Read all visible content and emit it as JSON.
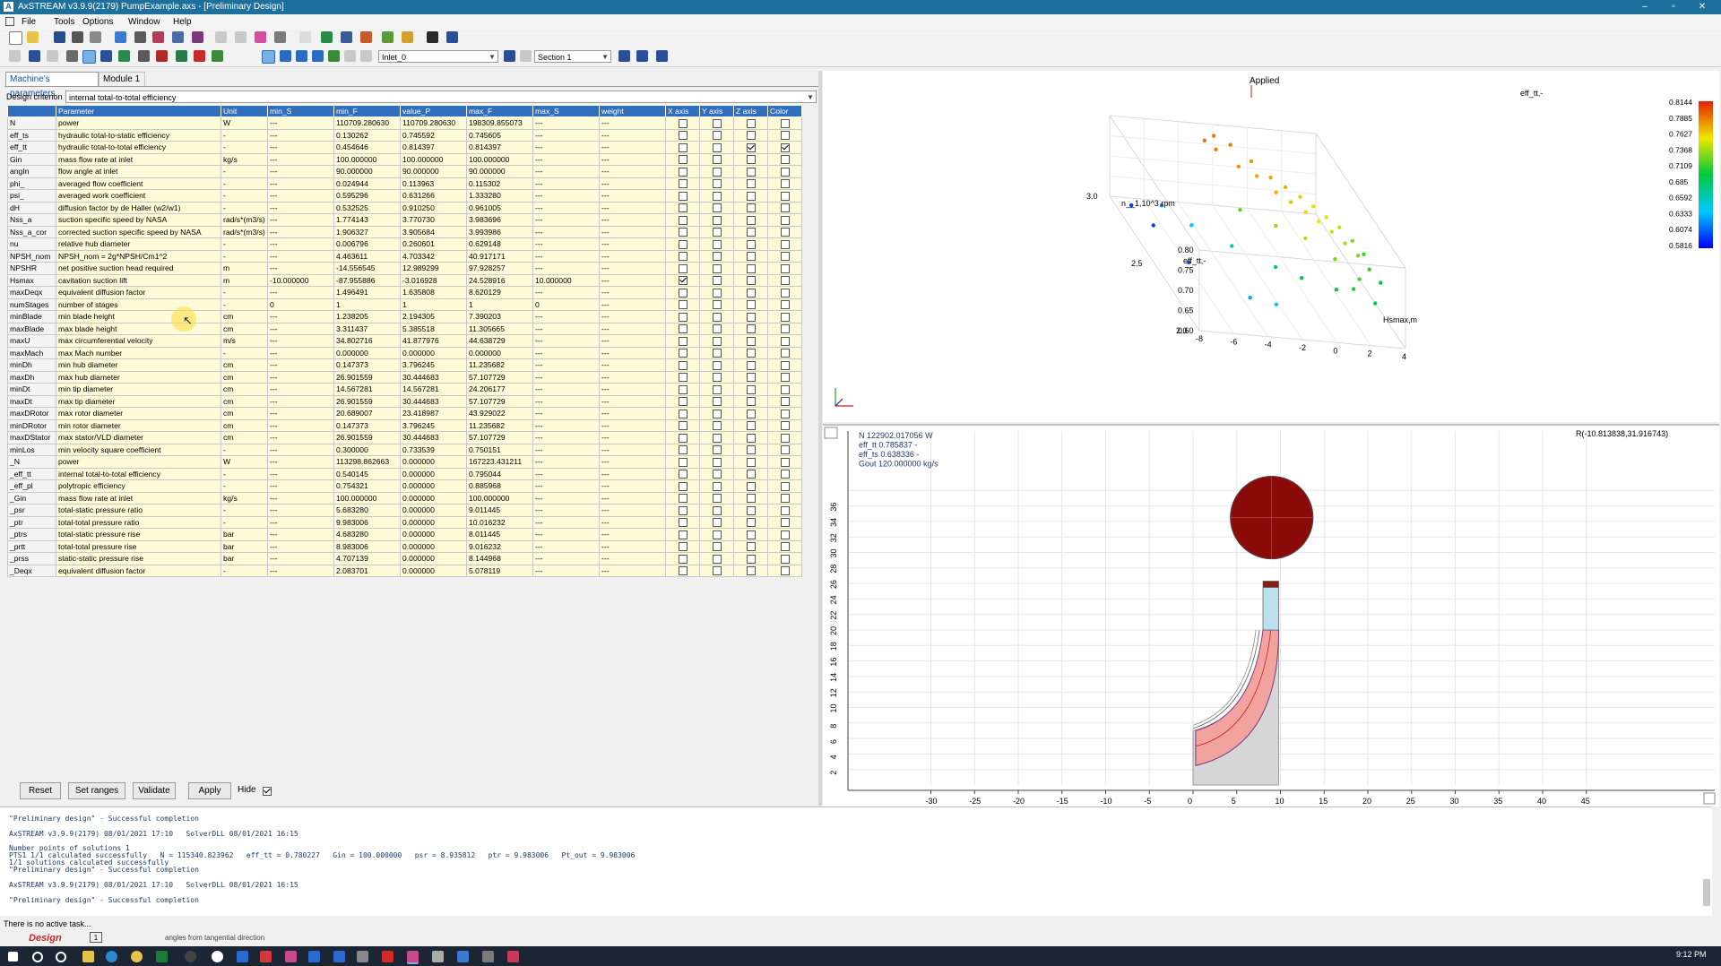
{
  "window": {
    "title": "AxSTREAM  v3.9.9(2179)  PumpExample.axs - [Preliminary Design]",
    "minimize": "–",
    "maximize": "▫",
    "close": "✕"
  },
  "menu": [
    "File",
    "Tools",
    "Options",
    "Window",
    "Help"
  ],
  "toolbar": {
    "inlet_combo": "Inlet_0",
    "section_combo": "Section 1"
  },
  "tabs": [
    "Machine's parameters",
    "Module 1"
  ],
  "design_criterion": {
    "label": "Design criterion",
    "value": "internal total-to-total efficiency"
  },
  "table": {
    "headers": [
      "",
      "Parameter",
      "Unit",
      "min_S",
      "min_F",
      "value_P",
      "max_F",
      "max_S",
      "weight",
      "X axis",
      "Y axis",
      "Z axis",
      "Color"
    ],
    "rows": [
      {
        "sym": "N",
        "param": "power",
        "unit": "W",
        "min_s": "---",
        "min_f": "110709.280630",
        "val": "110709.280630",
        "max_f": "198309.855073",
        "max_s": "---",
        "w": "---",
        "x": false,
        "y": false,
        "z": false,
        "c": false
      },
      {
        "sym": "eff_ts",
        "param": "hydraulic total-to-static efficiency",
        "unit": "-",
        "min_s": "---",
        "min_f": "0.130262",
        "val": "0.745592",
        "max_f": "0.745605",
        "max_s": "---",
        "w": "---",
        "x": false,
        "y": false,
        "z": false,
        "c": false
      },
      {
        "sym": "eff_tt",
        "param": "hydraulic total-to-total efficiency",
        "unit": "-",
        "min_s": "---",
        "min_f": "0.454646",
        "val": "0.814397",
        "max_f": "0.814397",
        "max_s": "---",
        "w": "---",
        "x": false,
        "y": false,
        "z": true,
        "c": true
      },
      {
        "sym": "Gin",
        "param": "mass flow rate at inlet",
        "unit": "kg/s",
        "min_s": "---",
        "min_f": "100.000000",
        "val": "100.000000",
        "max_f": "100.000000",
        "max_s": "---",
        "w": "---",
        "x": false,
        "y": false,
        "z": false,
        "c": false
      },
      {
        "sym": "angIn",
        "param": "flow angle at inlet",
        "unit": "-",
        "min_s": "---",
        "min_f": "90.000000",
        "val": "90.000000",
        "max_f": "90.000000",
        "max_s": "---",
        "w": "---",
        "x": false,
        "y": false,
        "z": false,
        "c": false
      },
      {
        "sym": "phi_",
        "param": "averaged flow coefficient",
        "unit": "-",
        "min_s": "---",
        "min_f": "0.024944",
        "val": "0.113963",
        "max_f": "0.115302",
        "max_s": "---",
        "w": "---",
        "x": false,
        "y": false,
        "z": false,
        "c": false
      },
      {
        "sym": "psi_",
        "param": "averaged work coefficient",
        "unit": "-",
        "min_s": "---",
        "min_f": "0.595296",
        "val": "0.631266",
        "max_f": "1.333280",
        "max_s": "---",
        "w": "---",
        "x": false,
        "y": false,
        "z": false,
        "c": false
      },
      {
        "sym": "dH",
        "param": "diffusion factor by de Haller (w2/w1)",
        "unit": "-",
        "min_s": "---",
        "min_f": "0.532525",
        "val": "0.910250",
        "max_f": "0.961005",
        "max_s": "---",
        "w": "---",
        "x": false,
        "y": false,
        "z": false,
        "c": false
      },
      {
        "sym": "Nss_a",
        "param": "suction specific speed by NASA",
        "unit": "rad/s*(m3/s)",
        "min_s": "---",
        "min_f": "1.774143",
        "val": "3.770730",
        "max_f": "3.983696",
        "max_s": "---",
        "w": "---",
        "x": false,
        "y": false,
        "z": false,
        "c": false
      },
      {
        "sym": "Nss_a_cor",
        "param": "corrected suction specific speed by NASA",
        "unit": "rad/s*(m3/s)",
        "min_s": "---",
        "min_f": "1.906327",
        "val": "3.905684",
        "max_f": "3.993986",
        "max_s": "---",
        "w": "---",
        "x": false,
        "y": false,
        "z": false,
        "c": false
      },
      {
        "sym": "nu",
        "param": "relative hub diameter",
        "unit": "-",
        "min_s": "---",
        "min_f": "0.006796",
        "val": "0.260601",
        "max_f": "0.629148",
        "max_s": "---",
        "w": "---",
        "x": false,
        "y": false,
        "z": false,
        "c": false
      },
      {
        "sym": "NPSH_nom",
        "param": "NPSH_nom = 2g*NPSH/Cm1^2",
        "unit": "-",
        "min_s": "---",
        "min_f": "4.463611",
        "val": "4.703342",
        "max_f": "40.917171",
        "max_s": "---",
        "w": "---",
        "x": false,
        "y": false,
        "z": false,
        "c": false
      },
      {
        "sym": "NPSHR",
        "param": "net positive suction head required",
        "unit": "m",
        "min_s": "---",
        "min_f": "-14.556545",
        "val": "12.989299",
        "max_f": "97.928257",
        "max_s": "---",
        "w": "---",
        "x": false,
        "y": false,
        "z": false,
        "c": false
      },
      {
        "sym": "Hsmax",
        "param": "cavitation suction lift",
        "unit": "m",
        "min_s": "-10.000000",
        "min_f": "-87.955886",
        "val": "-3.016928",
        "max_f": "24.528916",
        "max_s": "10.000000",
        "w": "---",
        "x": true,
        "y": false,
        "z": false,
        "c": false
      },
      {
        "sym": "maxDeqx",
        "param": "equivalent diffusion factor",
        "unit": "-",
        "min_s": "---",
        "min_f": "1.496491",
        "val": "1.635808",
        "max_f": "8.620129",
        "max_s": "---",
        "w": "---",
        "x": false,
        "y": false,
        "z": false,
        "c": false
      },
      {
        "sym": "numStages",
        "param": "number of stages",
        "unit": "-",
        "min_s": "0",
        "min_f": "1",
        "val": "1",
        "max_f": "1",
        "max_s": "0",
        "w": "---",
        "x": false,
        "y": false,
        "z": false,
        "c": false
      },
      {
        "sym": "minBlade",
        "param": "min blade height",
        "unit": "cm",
        "min_s": "---",
        "min_f": "1.238205",
        "val": "2.194305",
        "max_f": "7.390203",
        "max_s": "---",
        "w": "---",
        "x": false,
        "y": false,
        "z": false,
        "c": false
      },
      {
        "sym": "maxBlade",
        "param": "max blade height",
        "unit": "cm",
        "min_s": "---",
        "min_f": "3.311437",
        "val": "5.385518",
        "max_f": "11.305665",
        "max_s": "---",
        "w": "---",
        "x": false,
        "y": false,
        "z": false,
        "c": false
      },
      {
        "sym": "maxU",
        "param": "max circumferential velocity",
        "unit": "m/s",
        "min_s": "---",
        "min_f": "34.802716",
        "val": "41.877976",
        "max_f": "44.638729",
        "max_s": "---",
        "w": "---",
        "x": false,
        "y": false,
        "z": false,
        "c": false
      },
      {
        "sym": "maxMach",
        "param": "max Mach number",
        "unit": "-",
        "min_s": "---",
        "min_f": "0.000000",
        "val": "0.000000",
        "max_f": "0.000000",
        "max_s": "---",
        "w": "---",
        "x": false,
        "y": false,
        "z": false,
        "c": false
      },
      {
        "sym": "minDh",
        "param": "min hub diameter",
        "unit": "cm",
        "min_s": "---",
        "min_f": "0.147373",
        "val": "3.796245",
        "max_f": "11.235682",
        "max_s": "---",
        "w": "---",
        "x": false,
        "y": false,
        "z": false,
        "c": false
      },
      {
        "sym": "maxDh",
        "param": "max hub diameter",
        "unit": "cm",
        "min_s": "---",
        "min_f": "26.901559",
        "val": "30.444683",
        "max_f": "57.107729",
        "max_s": "---",
        "w": "---",
        "x": false,
        "y": false,
        "z": false,
        "c": false
      },
      {
        "sym": "minDt",
        "param": "min tip diameter",
        "unit": "cm",
        "min_s": "---",
        "min_f": "14.567281",
        "val": "14.567281",
        "max_f": "24.206177",
        "max_s": "---",
        "w": "---",
        "x": false,
        "y": false,
        "z": false,
        "c": false
      },
      {
        "sym": "maxDt",
        "param": "max tip diameter",
        "unit": "cm",
        "min_s": "---",
        "min_f": "26.901559",
        "val": "30.444683",
        "max_f": "57.107729",
        "max_s": "---",
        "w": "---",
        "x": false,
        "y": false,
        "z": false,
        "c": false
      },
      {
        "sym": "maxDRotor",
        "param": "max rotor diameter",
        "unit": "cm",
        "min_s": "---",
        "min_f": "20.689007",
        "val": "23.418987",
        "max_f": "43.929022",
        "max_s": "---",
        "w": "---",
        "x": false,
        "y": false,
        "z": false,
        "c": false
      },
      {
        "sym": "minDRotor",
        "param": "min rotor diameter",
        "unit": "cm",
        "min_s": "---",
        "min_f": "0.147373",
        "val": "3.796245",
        "max_f": "11.235682",
        "max_s": "---",
        "w": "---",
        "x": false,
        "y": false,
        "z": false,
        "c": false
      },
      {
        "sym": "maxDStator",
        "param": "max stator/VLD diameter",
        "unit": "cm",
        "min_s": "---",
        "min_f": "26.901559",
        "val": "30.444683",
        "max_f": "57.107729",
        "max_s": "---",
        "w": "---",
        "x": false,
        "y": false,
        "z": false,
        "c": false
      },
      {
        "sym": "minLos",
        "param": "min velocity square coefficient",
        "unit": "-",
        "min_s": "---",
        "min_f": "0.300000",
        "val": "0.733539",
        "max_f": "0.750151",
        "max_s": "---",
        "w": "---",
        "x": false,
        "y": false,
        "z": false,
        "c": false
      },
      {
        "sym": "_N",
        "param": "power",
        "unit": "W",
        "min_s": "---",
        "min_f": "113298.862663",
        "val": "0.000000",
        "max_f": "167223.431211",
        "max_s": "---",
        "w": "---",
        "x": false,
        "y": false,
        "z": false,
        "c": false
      },
      {
        "sym": "_eff_tt",
        "param": "internal total-to-total efficiency",
        "unit": "-",
        "min_s": "---",
        "min_f": "0.540145",
        "val": "0.000000",
        "max_f": "0.795044",
        "max_s": "---",
        "w": "---",
        "x": false,
        "y": false,
        "z": false,
        "c": false
      },
      {
        "sym": "_eff_pl",
        "param": "polytropic efficiency",
        "unit": "-",
        "min_s": "---",
        "min_f": "0.754321",
        "val": "0.000000",
        "max_f": "0.885968",
        "max_s": "---",
        "w": "---",
        "x": false,
        "y": false,
        "z": false,
        "c": false
      },
      {
        "sym": "_Gin",
        "param": "mass flow rate at inlet",
        "unit": "kg/s",
        "min_s": "---",
        "min_f": "100.000000",
        "val": "0.000000",
        "max_f": "100.000000",
        "max_s": "---",
        "w": "---",
        "x": false,
        "y": false,
        "z": false,
        "c": false
      },
      {
        "sym": "_psr",
        "param": "total-static pressure ratio",
        "unit": "-",
        "min_s": "---",
        "min_f": "5.683280",
        "val": "0.000000",
        "max_f": "9.011445",
        "max_s": "---",
        "w": "---",
        "x": false,
        "y": false,
        "z": false,
        "c": false
      },
      {
        "sym": "_ptr",
        "param": "total-total pressure ratio",
        "unit": "-",
        "min_s": "---",
        "min_f": "9.983006",
        "val": "0.000000",
        "max_f": "10.016232",
        "max_s": "---",
        "w": "---",
        "x": false,
        "y": false,
        "z": false,
        "c": false
      },
      {
        "sym": "_ptrs",
        "param": "total-static pressure rise",
        "unit": "bar",
        "min_s": "---",
        "min_f": "4.683280",
        "val": "0.000000",
        "max_f": "8.011445",
        "max_s": "---",
        "w": "---",
        "x": false,
        "y": false,
        "z": false,
        "c": false
      },
      {
        "sym": "_prtt",
        "param": "total-total pressure rise",
        "unit": "bar",
        "min_s": "---",
        "min_f": "8.983006",
        "val": "0.000000",
        "max_f": "9.016232",
        "max_s": "---",
        "w": "---",
        "x": false,
        "y": false,
        "z": false,
        "c": false
      },
      {
        "sym": "_prss",
        "param": "static-static pressure rise",
        "unit": "bar",
        "min_s": "---",
        "min_f": "4.707139",
        "val": "0.000000",
        "max_f": "8.144968",
        "max_s": "---",
        "w": "---",
        "x": false,
        "y": false,
        "z": false,
        "c": false
      },
      {
        "sym": "_Deqx",
        "param": "equivalent diffusion factor",
        "unit": "-",
        "min_s": "---",
        "min_f": "2.083701",
        "val": "0.000000",
        "max_f": "5.078119",
        "max_s": "---",
        "w": "---",
        "x": false,
        "y": false,
        "z": false,
        "c": false
      }
    ]
  },
  "buttons": {
    "reset": "Reset",
    "set_ranges": "Set ranges",
    "validate": "Validate",
    "apply": "Apply",
    "hide": "Hide"
  },
  "plot3d": {
    "title": "Applied",
    "x_label": "Hsmax,m",
    "y_label": "n__1,10^3 rpm",
    "z_label": "eff_tt,-",
    "color_label": "eff_tt,-",
    "x_ticks": [
      "-8",
      "-6",
      "-4",
      "-2",
      "0",
      "2",
      "4"
    ],
    "z_ticks": [
      "0.80",
      "0.75",
      "0.70",
      "0.65",
      "0.60"
    ],
    "y_ticks": [
      "3.0",
      "2.5",
      "2.0"
    ],
    "colorbar_ticks": [
      "0.8144",
      "0.7885",
      "0.7627",
      "0.7368",
      "0.7109",
      "0.685",
      "0.6592",
      "0.6333",
      "0.6074",
      "0.5816"
    ]
  },
  "chart_data": {
    "type": "scatter",
    "title": "Applied",
    "xlabel": "Hsmax,m",
    "ylabel": "n__1,10^3 rpm",
    "zlabel": "eff_tt,-",
    "xlim": [
      -8,
      4
    ],
    "ylim": [
      2.0,
      3.0
    ],
    "zlim": [
      0.6,
      0.8
    ],
    "color_range": [
      0.5816,
      0.8144
    ],
    "points": [
      {
        "x": -3.0,
        "y": 2.9,
        "z": 0.79
      },
      {
        "x": -2.2,
        "y": 2.95,
        "z": 0.788
      },
      {
        "x": -1.5,
        "y": 2.9,
        "z": 0.785
      },
      {
        "x": -0.8,
        "y": 2.8,
        "z": 0.78
      },
      {
        "x": -0.2,
        "y": 2.7,
        "z": 0.775
      },
      {
        "x": 0.4,
        "y": 2.65,
        "z": 0.77
      },
      {
        "x": 1.0,
        "y": 2.6,
        "z": 0.765
      },
      {
        "x": 1.5,
        "y": 2.55,
        "z": 0.76
      },
      {
        "x": 2.0,
        "y": 2.5,
        "z": 0.752
      },
      {
        "x": 2.5,
        "y": 2.45,
        "z": 0.745
      },
      {
        "x": 3.0,
        "y": 2.4,
        "z": 0.73
      },
      {
        "x": 3.4,
        "y": 2.35,
        "z": 0.715
      },
      {
        "x": -2.6,
        "y": 2.85,
        "z": 0.786
      },
      {
        "x": -1.8,
        "y": 2.75,
        "z": 0.78
      },
      {
        "x": -1.0,
        "y": 2.7,
        "z": 0.776
      },
      {
        "x": -0.4,
        "y": 2.6,
        "z": 0.771
      },
      {
        "x": 0.2,
        "y": 2.55,
        "z": 0.766
      },
      {
        "x": 0.8,
        "y": 2.5,
        "z": 0.76
      },
      {
        "x": 1.3,
        "y": 2.45,
        "z": 0.755
      },
      {
        "x": 1.8,
        "y": 2.4,
        "z": 0.748
      },
      {
        "x": 2.3,
        "y": 2.35,
        "z": 0.738
      },
      {
        "x": 2.8,
        "y": 2.3,
        "z": 0.726
      },
      {
        "x": 3.2,
        "y": 2.25,
        "z": 0.71
      },
      {
        "x": 3.6,
        "y": 2.2,
        "z": 0.695
      },
      {
        "x": -5.5,
        "y": 2.9,
        "z": 0.62
      },
      {
        "x": -4.8,
        "y": 2.7,
        "z": 0.64
      },
      {
        "x": -3.5,
        "y": 2.5,
        "z": 0.66
      },
      {
        "x": -6.5,
        "y": 2.8,
        "z": 0.6
      },
      {
        "x": -2.0,
        "y": 2.3,
        "z": 0.68
      },
      {
        "x": -1.0,
        "y": 2.2,
        "z": 0.69
      },
      {
        "x": 0.5,
        "y": 2.1,
        "z": 0.7
      },
      {
        "x": 1.5,
        "y": 2.1,
        "z": 0.705
      },
      {
        "x": 2.5,
        "y": 2.05,
        "z": 0.69
      },
      {
        "x": -4.0,
        "y": 2.2,
        "z": 0.63
      },
      {
        "x": -3.0,
        "y": 2.1,
        "z": 0.65
      },
      {
        "x": -7.0,
        "y": 2.95,
        "z": 0.598
      },
      {
        "x": -6.0,
        "y": 2.5,
        "z": 0.61
      },
      {
        "x": -2.5,
        "y": 2.6,
        "z": 0.72
      },
      {
        "x": -1.2,
        "y": 2.45,
        "z": 0.735
      },
      {
        "x": 0.0,
        "y": 2.35,
        "z": 0.742
      },
      {
        "x": 1.2,
        "y": 2.25,
        "z": 0.728
      },
      {
        "x": 2.1,
        "y": 2.15,
        "z": 0.715
      }
    ]
  },
  "meridional": {
    "info": [
      "N 122902.017056 W",
      "eff_tt 0.785837 -",
      "eff_ts 0.638336 -",
      "Gout 120.000000 kg/s"
    ],
    "coords": "R(-10.813838,31.916743)",
    "x_ticks": [
      "-30",
      "-25",
      "-20",
      "-15",
      "-10",
      "-5",
      "0",
      "5",
      "10",
      "15",
      "20",
      "25",
      "30",
      "35",
      "40",
      "45"
    ],
    "y_ticks": [
      "36",
      "34",
      "32",
      "30",
      "28",
      "26",
      "24",
      "22",
      "20",
      "18",
      "16",
      "14",
      "12",
      "10",
      "8",
      "6",
      "4",
      "2"
    ]
  },
  "log": [
    "\"Preliminary design\" - Successful completion",
    "AxSTREAM v3.9.9(2179) 08/01/2021 17:10   SolverDLL 08/01/2021 16:15",
    "Number points of solutions 1",
    "PTS1 1/1 calculated successfully   N = 115340.823962   eff_tt = 0.780227   Gin = 100.000000   psr = 8.935812   ptr = 9.983006   Pt_out = 9.983006",
    "1/1 solutions calculated successfully",
    "\"Preliminary design\" - Successful completion",
    "AxSTREAM v3.9.9(2179) 08/01/2021 17:10   SolverDLL 08/01/2021 16:15",
    "\"Preliminary design\" - Successful completion"
  ],
  "status": {
    "task": "There is no active task...",
    "mode": "Design",
    "page": "1",
    "hint": "angles from tangential direction"
  },
  "taskbar": {
    "clock": "9:12 PM"
  }
}
